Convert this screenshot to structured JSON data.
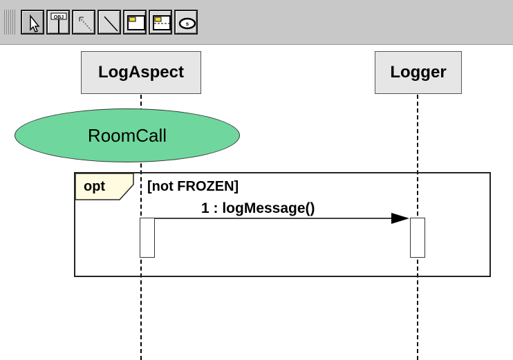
{
  "toolbar": {
    "tools": [
      {
        "name": "select-tool",
        "icon": "pointer-icon",
        "active": true
      },
      {
        "name": "object-lifeline-tool",
        "icon": "object-icon",
        "label": "OBJ"
      },
      {
        "name": "dashed-line-tool",
        "icon": "dashed-line-icon"
      },
      {
        "name": "message-line-tool",
        "icon": "line-icon"
      },
      {
        "name": "note-tool",
        "icon": "note-icon"
      },
      {
        "name": "fragment-tool",
        "icon": "fragment-icon"
      },
      {
        "name": "interaction-use-tool",
        "icon": "ellipse-icon",
        "label": "s"
      }
    ]
  },
  "diagram": {
    "lifelines": [
      {
        "name": "LogAspect"
      },
      {
        "name": "Logger"
      }
    ],
    "use_case": {
      "label": "RoomCall",
      "fill": "#6fd79d"
    },
    "fragment": {
      "operator": "opt",
      "guard": "[not FROZEN]"
    },
    "message": {
      "label": "1 : logMessage()"
    }
  }
}
